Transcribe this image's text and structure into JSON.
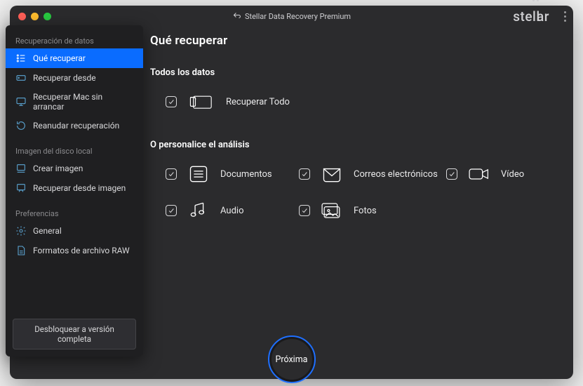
{
  "header": {
    "title": "Stellar Data Recovery Premium",
    "brand_a": "ste",
    "brand_b": "ar"
  },
  "sidebar": {
    "sections": [
      {
        "title": "Recuperación de datos",
        "items": [
          {
            "label": "Qué recuperar",
            "icon": "list-icon",
            "active": true
          },
          {
            "label": "Recuperar desde",
            "icon": "drive-icon",
            "active": false
          },
          {
            "label": "Recuperar Mac sin arrancar",
            "icon": "monitor-icon",
            "active": false
          },
          {
            "label": "Reanudar recuperación",
            "icon": "rotate-icon",
            "active": false
          }
        ]
      },
      {
        "title": "Imagen del disco local",
        "items": [
          {
            "label": "Crear imagen",
            "icon": "image-disk-icon",
            "active": false
          },
          {
            "label": "Recuperar desde imagen",
            "icon": "image-recover-icon",
            "active": false
          }
        ]
      },
      {
        "title": "Preferencias",
        "items": [
          {
            "label": "General",
            "icon": "gear-icon",
            "active": false
          },
          {
            "label": "Formatos de archivo RAW",
            "icon": "raw-icon",
            "active": false
          }
        ]
      }
    ],
    "unlock_label": "Desbloquear a versión completa"
  },
  "main": {
    "title": "Qué recuperar",
    "all_section_title": "Todos los datos",
    "all_label": "Recuperar Todo",
    "custom_section_title": "O personalice el análisis",
    "options": [
      {
        "label": "Documentos",
        "icon": "documents-icon"
      },
      {
        "label": "Correos electrónicos",
        "icon": "mail-icon"
      },
      {
        "label": "Vídeo",
        "icon": "video-icon"
      },
      {
        "label": "Audio",
        "icon": "audio-icon"
      },
      {
        "label": "Fotos",
        "icon": "photos-icon"
      }
    ],
    "next_label": "Próxima"
  },
  "colors": {
    "accent": "#0a6cff"
  }
}
